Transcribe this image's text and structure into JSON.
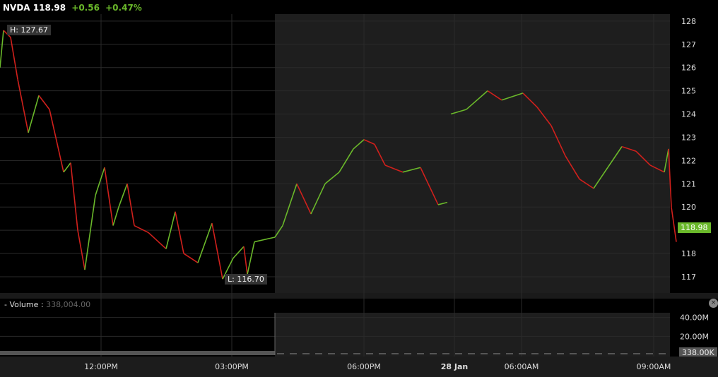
{
  "header": {
    "symbol": "NVDA",
    "price": "118.98",
    "change": "+0.56",
    "change_pct": "+0.47%"
  },
  "high_label": "H: 127.67",
  "low_label": "L: 116.70",
  "last_tag": "118.98",
  "volume": {
    "label": "- Volume :",
    "value": "338,004.00",
    "ticks": [
      "40.00M",
      "20.00M"
    ],
    "last_tag": "338.00K"
  },
  "colors": {
    "up": "#6ab82a",
    "down": "#d0201c",
    "shade": "#1e1e1e"
  },
  "chart_data": {
    "type": "line",
    "title": "NVDA",
    "ylim": [
      116.3,
      128.3
    ],
    "yticks": [
      128,
      127,
      126,
      125,
      124,
      123,
      122,
      121,
      120,
      119,
      118,
      117
    ],
    "xlim": [
      0,
      958
    ],
    "xticks": [
      {
        "label": "12:00PM",
        "x": 143
      },
      {
        "label": "03:00PM",
        "x": 328
      },
      {
        "label": "06:00PM",
        "x": 515
      },
      {
        "label": "28 Jan",
        "x": 643,
        "bold": true
      },
      {
        "label": "06:00AM",
        "x": 738
      },
      {
        "label": "09:00AM",
        "x": 925
      }
    ],
    "extended_session_start": 389,
    "x": [
      0,
      5,
      15,
      25,
      40,
      55,
      70,
      90,
      100,
      110,
      120,
      135,
      148,
      160,
      168,
      180,
      190,
      210,
      235,
      248,
      260,
      280,
      300,
      315,
      330,
      345,
      350,
      360,
      389,
      400,
      420,
      440,
      460,
      480,
      500,
      515,
      530,
      545,
      570,
      595,
      620,
      633,
      635,
      638,
      660,
      690,
      710,
      740,
      760,
      780,
      800,
      820,
      840,
      860,
      880,
      900,
      920,
      940,
      946,
      950,
      957
    ],
    "values": [
      126,
      127.6,
      127.3,
      125.5,
      123.2,
      124.8,
      124.2,
      121.5,
      121.9,
      119,
      117.3,
      120.5,
      121.7,
      119.2,
      120,
      121,
      119.2,
      118.9,
      118.2,
      119.8,
      118,
      117.6,
      119.3,
      116.9,
      117.8,
      118.3,
      117.1,
      118.5,
      118.7,
      119.2,
      121,
      119.7,
      121,
      121.5,
      122.5,
      122.9,
      122.7,
      121.8,
      121.5,
      121.7,
      120.1,
      120.2,
      null,
      124,
      124.2,
      125,
      124.6,
      124.9,
      124.3,
      123.5,
      122.2,
      121.2,
      120.8,
      121.7,
      122.6,
      122.4,
      121.8,
      121.5,
      122.5,
      120,
      118.5
    ],
    "volume_ylim": [
      0,
      45000000
    ]
  }
}
